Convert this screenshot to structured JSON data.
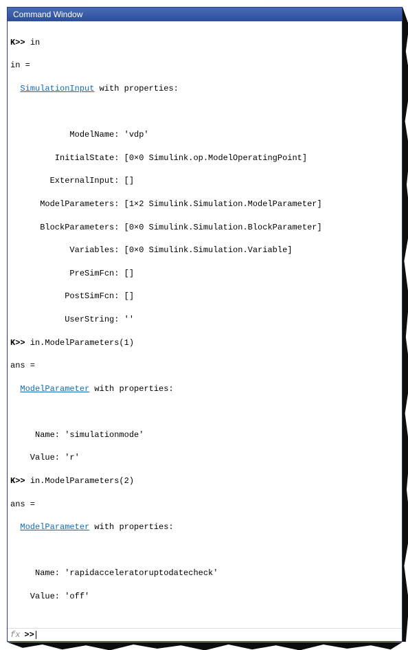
{
  "window": {
    "title": "Command Window"
  },
  "prompt": "K>>",
  "commands": {
    "c1": "in",
    "c2": "in.ModelParameters(1)",
    "c3": "in.ModelParameters(2)"
  },
  "out1": {
    "var": "in =",
    "indent2": "  ",
    "link": "SimulationInput",
    "with": " with properties:",
    "props": {
      "ModelName": "            ModelName: 'vdp'",
      "InitialState": "         InitialState: [0×0 Simulink.op.ModelOperatingPoint]",
      "ExternalInput": "        ExternalInput: []",
      "ModelParameters": "      ModelParameters: [1×2 Simulink.Simulation.ModelParameter]",
      "BlockParameters": "      BlockParameters: [0×0 Simulink.Simulation.BlockParameter]",
      "Variables": "            Variables: [0×0 Simulink.Simulation.Variable]",
      "PreSimFcn": "            PreSimFcn: []",
      "PostSimFcn": "           PostSimFcn: []",
      "UserString": "           UserString: ''"
    }
  },
  "out2": {
    "var": "ans =",
    "indent2": "  ",
    "link": "ModelParameter",
    "with": " with properties:",
    "props": {
      "Name": "     Name: 'simulationmode'",
      "Value": "    Value: 'r'"
    }
  },
  "out3": {
    "var": "ans =",
    "indent2": "  ",
    "link": "ModelParameter",
    "with": " with properties:",
    "props": {
      "Name": "     Name: 'rapidacceleratoruptodatecheck'",
      "Value": "    Value: 'off'"
    }
  },
  "fx": {
    "icon": "fx",
    "prompt": ">> "
  }
}
